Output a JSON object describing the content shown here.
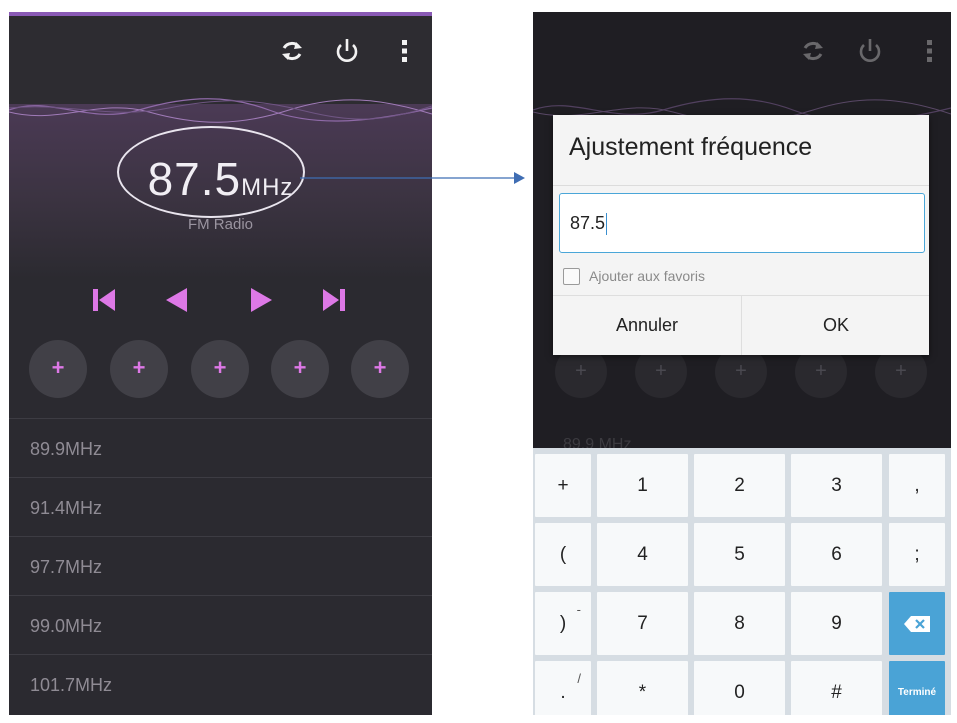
{
  "fm_radio": {
    "frequency": "87.5",
    "unit": "MHz",
    "station_label": "FM Radio",
    "icons": {
      "refresh": "refresh-icon",
      "power": "power-icon",
      "menu": "more-vert-icon",
      "skip_previous": "skip-previous-icon",
      "seek_back": "seek-back-icon",
      "seek_forward": "seek-forward-icon",
      "skip_next": "skip-next-icon"
    },
    "presets": [
      "+",
      "+",
      "+",
      "+",
      "+"
    ],
    "stations": [
      "89.9MHz",
      "91.4MHz",
      "97.7MHz",
      "99.0MHz",
      "101.7MHz"
    ],
    "colors": {
      "accent": "#dd78e6",
      "background": "#2b2a30"
    }
  },
  "dialog": {
    "title": "Ajustement fréquence",
    "input_value": "87.5",
    "checkbox_label": "Ajouter aux favoris",
    "cancel_label": "Annuler",
    "ok_label": "OK",
    "background_list_hint": "89.9 MHz"
  },
  "keyboard": {
    "rows": [
      [
        "+",
        "1",
        "2",
        "3",
        ","
      ],
      [
        "(",
        "4",
        "5",
        "6",
        ";"
      ],
      [
        ")",
        "7",
        "8",
        "9",
        "backspace"
      ],
      [
        ".",
        "*",
        "0",
        "#",
        "Terminé"
      ]
    ],
    "sub_labels": {
      "row3_col0": "-",
      "row4_col0": "/"
    },
    "done_label": "Terminé",
    "colors": {
      "action_key": "#4aa3d6"
    }
  }
}
